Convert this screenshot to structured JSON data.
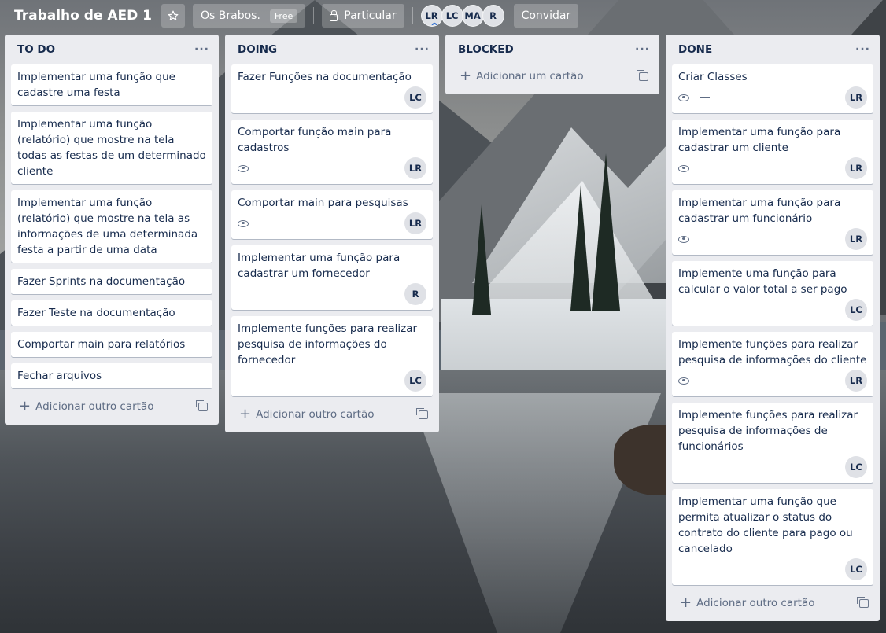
{
  "header": {
    "board_title": "Trabalho de AED 1",
    "team_name": "Os Brabos.",
    "team_badge": "Free",
    "visibility": "Particular",
    "members": [
      "LR",
      "LC",
      "MA",
      "R"
    ],
    "invite_label": "Convidar"
  },
  "lists": [
    {
      "title": "TO DO",
      "add_label": "Adicionar outro cartão",
      "cards": [
        {
          "title": "Implementar uma função que cadastre uma festa"
        },
        {
          "title": "Implementar uma função (relatório) que mostre na tela todas as festas de um determinado cliente"
        },
        {
          "title": "Implementar uma função (relatório) que mostre na tela as informações de uma determinada festa a partir de uma data"
        },
        {
          "title": "Fazer Sprints na documentação"
        },
        {
          "title": "Fazer Teste na documentação"
        },
        {
          "title": "Comportar main para relatórios"
        },
        {
          "title": "Fechar arquivos"
        }
      ]
    },
    {
      "title": "DOING",
      "add_label": "Adicionar outro cartão",
      "cards": [
        {
          "title": "Fazer Funções na documentação",
          "member": "LC"
        },
        {
          "title": "Comportar função main para cadastros",
          "watch": true,
          "member": "LR"
        },
        {
          "title": "Comportar main para pesquisas",
          "watch": true,
          "member": "LR"
        },
        {
          "title": "Implementar uma função para cadastrar um fornecedor",
          "member": "R"
        },
        {
          "title": "Implemente funções para realizar pesquisa de informações do fornecedor",
          "member": "LC"
        }
      ]
    },
    {
      "title": "BLOCKED",
      "add_label": "Adicionar um cartão",
      "cards": []
    },
    {
      "title": "DONE",
      "add_label": "Adicionar outro cartão",
      "cards": [
        {
          "title": "Criar Classes",
          "watch": true,
          "description": true,
          "member": "LR"
        },
        {
          "title": "Implementar uma função para cadastrar um cliente",
          "watch": true,
          "member": "LR"
        },
        {
          "title": "Implementar uma função para cadastrar um funcionário",
          "watch": true,
          "member": "LR"
        },
        {
          "title": "Implemente uma função para calcular o valor total a ser pago",
          "member": "LC"
        },
        {
          "title": "Implemente funções para realizar pesquisa de informações do cliente",
          "watch": true,
          "member": "LR"
        },
        {
          "title": "Implemente funções para realizar pesquisa de informações de funcionários",
          "member": "LC"
        },
        {
          "title": "Implementar uma função que permita atualizar o status do contrato do cliente para pago ou cancelado",
          "member": "LC"
        }
      ]
    }
  ],
  "icons": {
    "star": "star-icon",
    "lock": "lock-icon",
    "watch": "eye-icon",
    "description": "description-icon",
    "add": "plus-icon",
    "template": "card-template-icon",
    "menu": "more-horizontal-icon"
  },
  "colors": {
    "list_bg": "#ebecf0",
    "card_bg": "#ffffff",
    "text": "#172b4d",
    "muted": "#5e6c84",
    "avatar_bg": "#dfe1e6"
  }
}
